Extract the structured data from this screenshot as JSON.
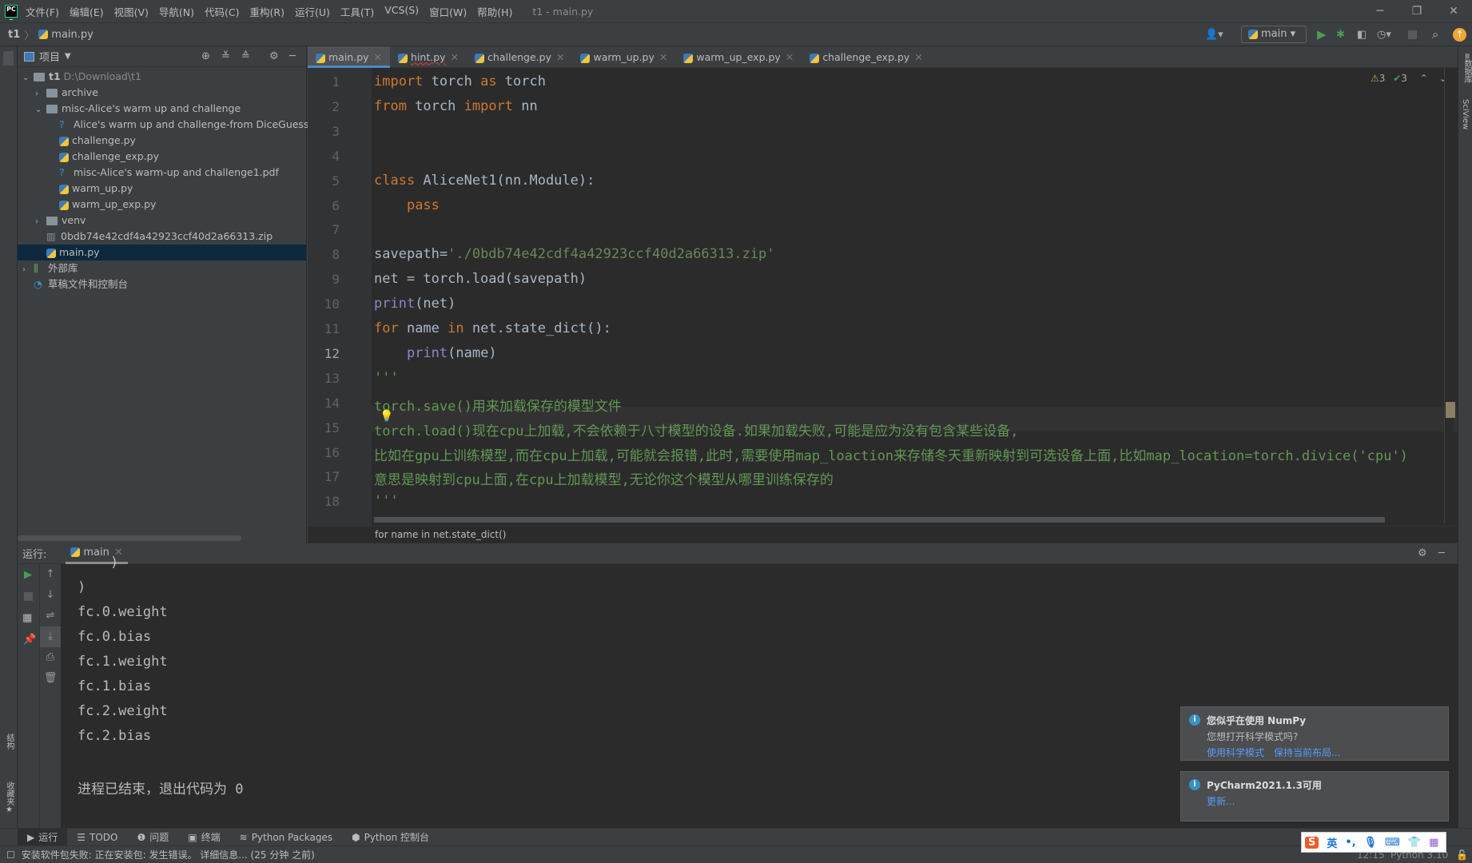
{
  "menubar": {
    "logo": "PC",
    "items": [
      "文件(F)",
      "编辑(E)",
      "视图(V)",
      "导航(N)",
      "代码(C)",
      "重构(R)",
      "运行(U)",
      "工具(T)",
      "VCS(S)",
      "窗口(W)",
      "帮助(H)"
    ],
    "title": "t1 - main.py"
  },
  "navbar": {
    "project": "t1",
    "file": "main.py",
    "run_config": "main"
  },
  "project_panel": {
    "title": "项目",
    "root": "t1",
    "root_path": "D:\\Download\\t1",
    "items": [
      {
        "label": "archive",
        "depth": 1,
        "type": "folder",
        "arrow": "›"
      },
      {
        "label": "misc-Alice's warm up and challenge",
        "depth": 1,
        "type": "folder",
        "arrow": "⌄"
      },
      {
        "label": "Alice's warm up and challenge-from DiceGuesser",
        "depth": 2,
        "type": "unknown"
      },
      {
        "label": "challenge.py",
        "depth": 2,
        "type": "py"
      },
      {
        "label": "challenge_exp.py",
        "depth": 2,
        "type": "py"
      },
      {
        "label": "misc-Alice's warm-up and challenge1.pdf",
        "depth": 2,
        "type": "unknown"
      },
      {
        "label": "warm_up.py",
        "depth": 2,
        "type": "py"
      },
      {
        "label": "warm_up_exp.py",
        "depth": 2,
        "type": "py"
      },
      {
        "label": "venv",
        "depth": 1,
        "type": "folder",
        "arrow": "›"
      },
      {
        "label": "0bdb74e42cdf4a42923ccf40d2a66313.zip",
        "depth": 1,
        "type": "zip"
      },
      {
        "label": "main.py",
        "depth": 1,
        "type": "py",
        "selected": true
      },
      {
        "label": "外部库",
        "depth": 0,
        "type": "lib",
        "arrow": "›"
      },
      {
        "label": "草稿文件和控制台",
        "depth": 0,
        "type": "scratch"
      }
    ]
  },
  "tabs": [
    {
      "label": "main.py",
      "active": true
    },
    {
      "label": "hint.py"
    },
    {
      "label": "challenge.py"
    },
    {
      "label": "warm_up.py"
    },
    {
      "label": "warm_up_exp.py"
    },
    {
      "label": "challenge_exp.py"
    }
  ],
  "inspections": {
    "warnings": "3",
    "typos": "3"
  },
  "code": {
    "current_line": 12,
    "lines": [
      [
        [
          "kw",
          "import "
        ],
        [
          "tx",
          "torch "
        ],
        [
          "kw",
          "as "
        ],
        [
          "tx",
          "torch"
        ]
      ],
      [
        [
          "kw",
          "from "
        ],
        [
          "tx",
          "torch "
        ],
        [
          "kw",
          "import "
        ],
        [
          "tx",
          "nn"
        ]
      ],
      [],
      [],
      [
        [
          "kw",
          "class "
        ],
        [
          "tx",
          "AliceNet1(nn.Module):"
        ]
      ],
      [
        [
          "tx",
          "    "
        ],
        [
          "kw",
          "pass"
        ]
      ],
      [],
      [
        [
          "tx",
          "savepath="
        ],
        [
          "str",
          "'./0bdb74e42cdf4a42923ccf40d2a66313.zip'"
        ]
      ],
      [
        [
          "tx",
          "net = torch.load(savepath)"
        ]
      ],
      [
        [
          "bi",
          "print"
        ],
        [
          "tx",
          "(net)"
        ]
      ],
      [
        [
          "kw",
          "for "
        ],
        [
          "tx",
          "name "
        ],
        [
          "kw",
          "in "
        ],
        [
          "tx",
          "net.state_dict():"
        ]
      ],
      [
        [
          "tx",
          "    "
        ],
        [
          "bi",
          "print"
        ],
        [
          "tx",
          "(name)"
        ]
      ],
      [
        [
          "doc",
          "'''"
        ]
      ],
      [
        [
          "doc",
          "torch.save()用来加载保存的模型文件"
        ]
      ],
      [
        [
          "doc",
          "torch.load()现在cpu上加载,不会依赖于八寸模型的设备.如果加载失败,可能是应为没有包含某些设备,"
        ]
      ],
      [
        [
          "doc",
          "比如在gpu上训练模型,而在cpu上加载,可能就会报错,此时,需要使用map_loaction来存储冬天重新映射到可选设备上面,比如map_location=torch.divice('cpu')"
        ]
      ],
      [
        [
          "doc",
          "意思是映射到cpu上面,在cpu上加载模型,无论你这个模型从哪里训练保存的"
        ]
      ],
      [
        [
          "doc",
          "'''"
        ]
      ]
    ]
  },
  "editor_breadcrumb": "for name in net.state_dict()",
  "run_panel": {
    "label": "运行:",
    "tab": "main",
    "output": [
      "    )",
      ")",
      "fc.0.weight",
      "fc.0.bias",
      "fc.1.weight",
      "fc.1.bias",
      "fc.2.weight",
      "fc.2.bias",
      "",
      "进程已结束，退出代码为 0"
    ]
  },
  "notifications": [
    {
      "title": "您似乎在使用 NumPy",
      "body": "您想打开科学模式吗?",
      "links": [
        "使用科学模式",
        "保持当前布局..."
      ]
    },
    {
      "title": "PyCharm2021.1.3可用",
      "links": [
        "更新..."
      ]
    }
  ],
  "bottom_tools": [
    "运行",
    "TODO",
    "问题",
    "终端",
    "Python Packages",
    "Python 控制台"
  ],
  "status": {
    "message": "安装软件包失败: 正在安装包: 发生错误。 详细信息... (25 分钟 之前)",
    "position": "12:15",
    "interpreter": "Python 3.10"
  },
  "ime": {
    "label": "英"
  },
  "colors": {
    "keyword": "#cc7832",
    "string": "#6a8759",
    "builtin": "#8888c6",
    "docstring": "#629755",
    "selection": "#0d293e",
    "accent": "#4a88c7"
  }
}
